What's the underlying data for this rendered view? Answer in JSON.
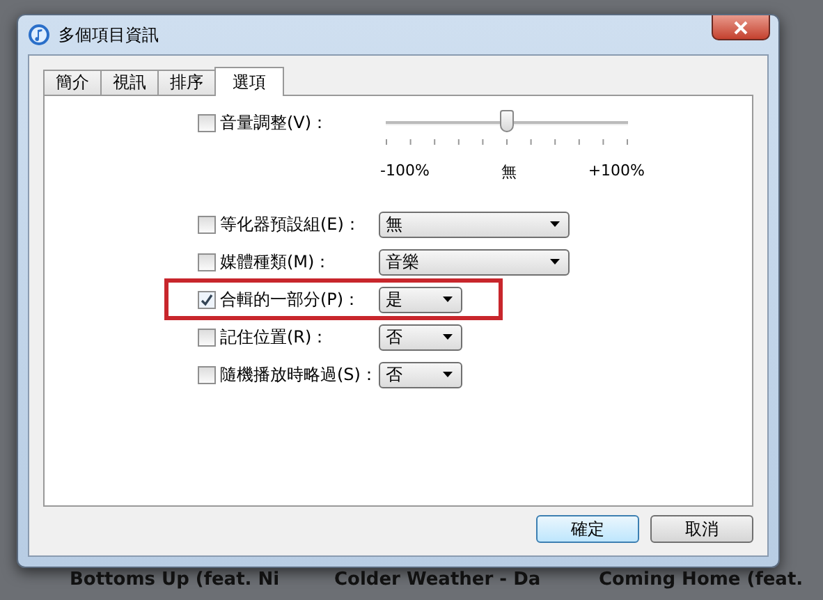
{
  "window": {
    "title": "多個項目資訊"
  },
  "tabs": [
    {
      "label": "簡介",
      "selected": false
    },
    {
      "label": "視訊",
      "selected": false
    },
    {
      "label": "排序",
      "selected": false
    },
    {
      "label": "選項",
      "selected": true
    }
  ],
  "volume": {
    "label": "音量調整(V)：",
    "checked": false,
    "level": 0.5,
    "scale_labels": [
      "-100%",
      "無",
      "+100%"
    ]
  },
  "options": [
    {
      "label": "等化器預設組(E)：",
      "checked": false,
      "value": "無",
      "wide": true,
      "highlighted": false
    },
    {
      "label": "媒體種類(M)：",
      "checked": false,
      "value": "音樂",
      "wide": true,
      "highlighted": false
    },
    {
      "label": "合輯的一部分(P)：",
      "checked": true,
      "value": "是",
      "wide": false,
      "highlighted": true
    },
    {
      "label": "記住位置(R)：",
      "checked": false,
      "value": "否",
      "wide": false,
      "highlighted": false
    },
    {
      "label": "隨機播放時略過(S)：",
      "checked": false,
      "value": "否",
      "wide": false,
      "highlighted": false
    }
  ],
  "buttons": [
    {
      "label": "確定",
      "default": true
    },
    {
      "label": "取消",
      "default": false
    }
  ],
  "background_rows": [
    "Bottoms Up (feat. Ni",
    "Colder Weather - Da",
    "Coming Home (feat."
  ]
}
